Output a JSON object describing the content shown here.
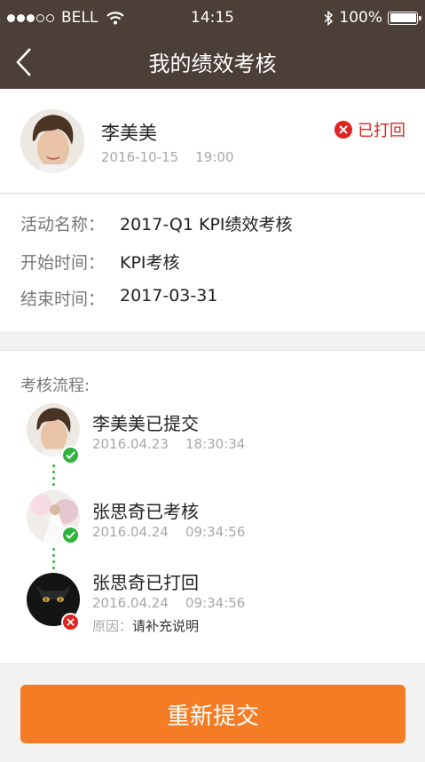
{
  "status_bar": {
    "carrier": "BELL",
    "time": "14:15",
    "battery": "100%"
  },
  "nav": {
    "title": "我的绩效考核"
  },
  "user": {
    "name": "李美美",
    "date": "2016-10-15",
    "time": "19:00",
    "status": "已打回",
    "status_color": "#e0241f"
  },
  "info": {
    "rows": [
      {
        "label": "活动名称：",
        "value": "2017-Q1 KPI绩效考核"
      },
      {
        "label": "开始时间：",
        "value": "KPI考核"
      },
      {
        "label": "结束时间：",
        "value": "2017-03-31"
      }
    ]
  },
  "flow": {
    "title": "考核流程:",
    "steps": [
      {
        "title": "李美美已提交",
        "date": "2016.04.23",
        "time": "18:30:34",
        "state": "ok"
      },
      {
        "title": "张思奇已考核",
        "date": "2016.04.24",
        "time": "09:34:56",
        "state": "ok"
      },
      {
        "title": "张思奇已打回",
        "date": "2016.04.24",
        "time": "09:34:56",
        "state": "rejected",
        "reason_label": "原因：",
        "reason": "请补充说明"
      }
    ]
  },
  "submit": {
    "label": "重新提交"
  },
  "colors": {
    "header": "#4b3f38",
    "accent": "#f47c24",
    "success": "#2fb33d",
    "danger": "#e0241f"
  }
}
